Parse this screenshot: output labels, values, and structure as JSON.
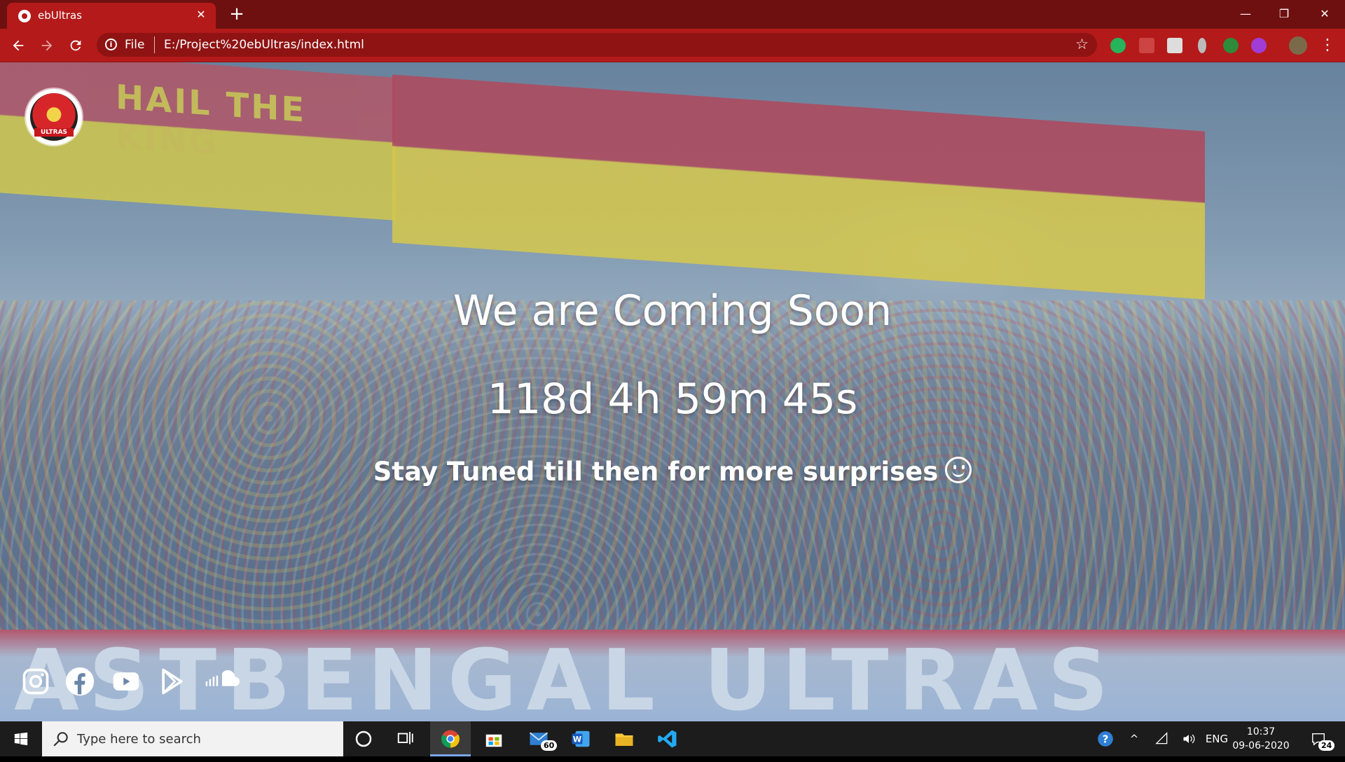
{
  "browser": {
    "tab_title": "ebUltras",
    "tab_close": "✕",
    "new_tab": "+",
    "scheme_label": "File",
    "url": "E:/Project%20ebUltras/index.html",
    "window_controls": {
      "minimize": "—",
      "restore": "❐",
      "close": "✕"
    },
    "accent_color": "#b41a1a"
  },
  "page": {
    "banner_text_top": "HAIL THE KING",
    "banner_text_bottom": "ASTBENGAL ULTRAS",
    "logo_label": "ULTRAS",
    "headline": "We are Coming Soon",
    "countdown": "118d 4h 59m 45s",
    "tagline": "Stay Tuned till then for more surprises",
    "social": [
      "instagram-icon",
      "facebook-icon",
      "youtube-icon",
      "play-store-icon",
      "soundcloud-icon"
    ]
  },
  "taskbar": {
    "search_placeholder": "Type here to search",
    "mail_badge": "60",
    "language": "ENG",
    "time": "10:37",
    "date": "09-06-2020",
    "notifications_badge": "24"
  }
}
